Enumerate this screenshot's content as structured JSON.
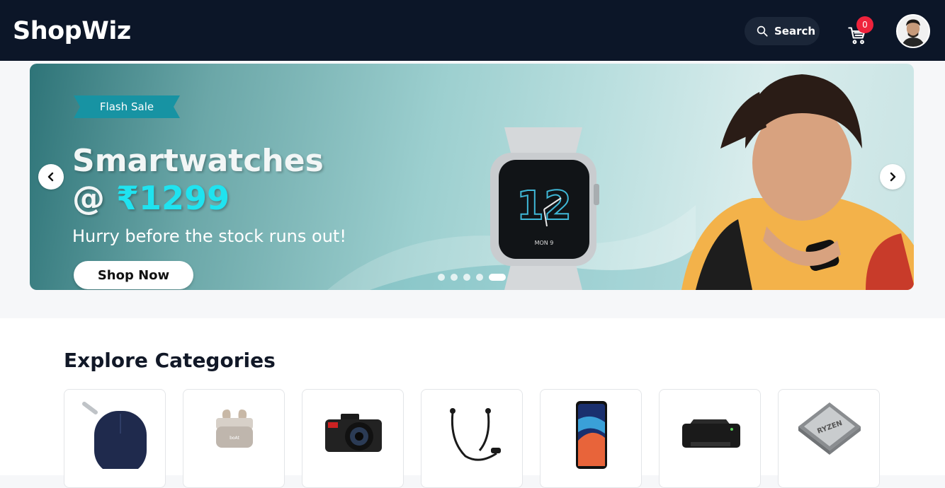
{
  "header": {
    "logo": "ShopWiz",
    "search_label": "Search",
    "cart_count": "0"
  },
  "banner": {
    "ribbon": "Flash Sale",
    "title_line1": "Smartwatches",
    "title_at": "@ ",
    "title_price": "₹1299",
    "tagline": "Hurry before the stock runs out!",
    "cta": "Shop Now",
    "watch_time": "12",
    "watch_date": "MON 9",
    "slides_total": 5,
    "active_slide": 5
  },
  "categories": {
    "title": "Explore Categories",
    "items": [
      {
        "icon": "mouse-icon"
      },
      {
        "icon": "earbuds-icon"
      },
      {
        "icon": "camera-icon"
      },
      {
        "icon": "neckband-icon"
      },
      {
        "icon": "smartphone-icon"
      },
      {
        "icon": "printer-icon"
      },
      {
        "icon": "processor-icon"
      }
    ]
  },
  "colors": {
    "header_bg": "#0c1628",
    "badge": "#ef233c",
    "ribbon": "#1793a3",
    "price_accent": "#1fe3f0"
  }
}
